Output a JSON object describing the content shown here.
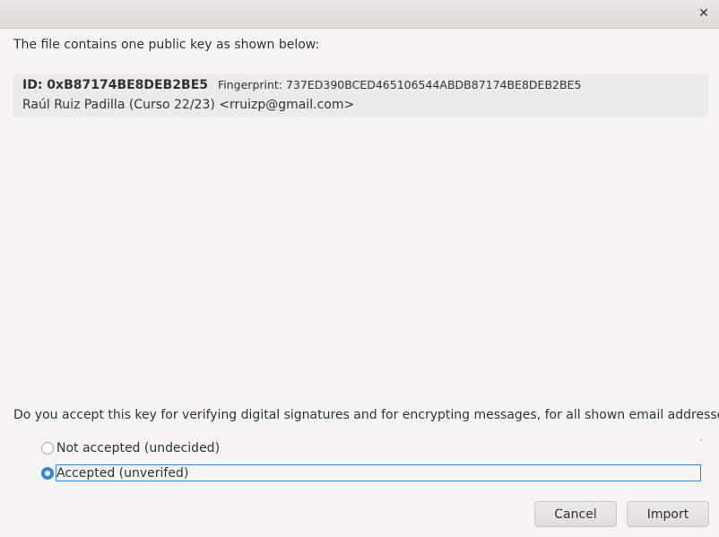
{
  "window": {
    "close_icon": "close-icon"
  },
  "intro_text": "The file contains one public key as shown below:",
  "key": {
    "id": "ID: 0xB87174BE8DEB2BE5",
    "fingerprint": "Fingerprint: 737ED390BCED465106544ABDB87174BE8DEB2BE5",
    "user": "Raúl Ruiz Padilla (Curso 22/23) <rruizp@gmail.com>"
  },
  "question": "Do you accept this key for verifying digital signatures and for encrypting messages, for all shown email addresses?",
  "options": [
    {
      "label": "Not accepted (undecided)",
      "checked": false
    },
    {
      "label": "Accepted (unverifed)",
      "checked": true
    }
  ],
  "buttons": {
    "cancel": "Cancel",
    "import": "Import"
  },
  "colors": {
    "accent": "#3584e4"
  }
}
